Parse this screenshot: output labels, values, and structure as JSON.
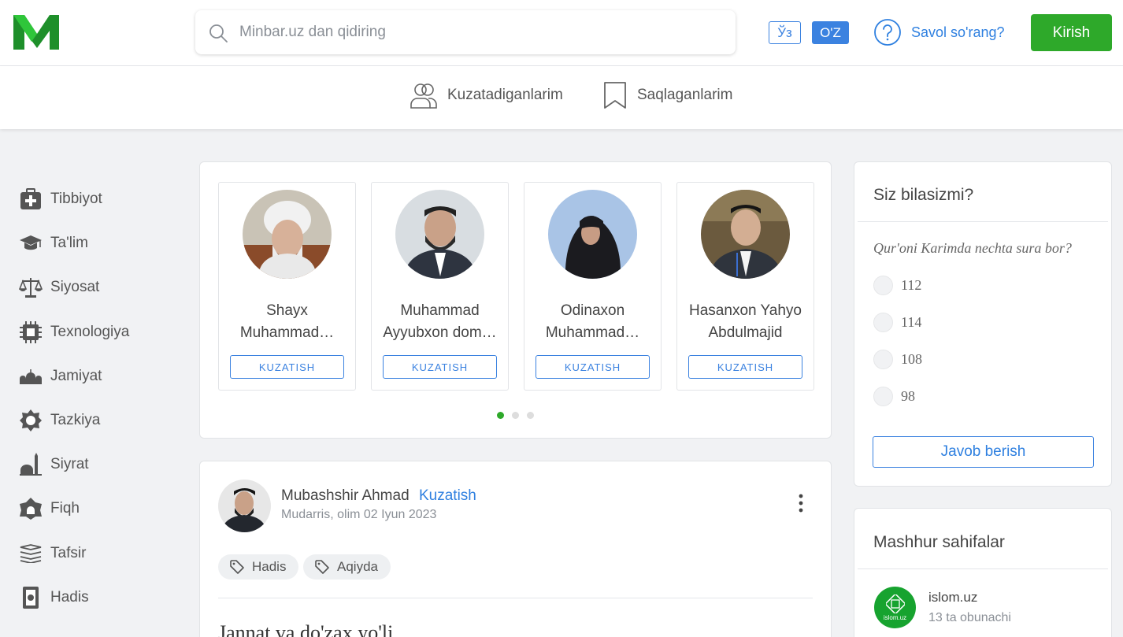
{
  "header": {
    "logo": "M",
    "search": {
      "placeholder": "Minbar.uz dan qidiring"
    },
    "lang_cyrillic": "Ўз",
    "lang_latin": "O'Z",
    "ask_label": "Savol so'rang?",
    "login_label": "Kirish"
  },
  "subnav": {
    "following": "Kuzatadiganlarim",
    "saved": "Saqlaganlarim"
  },
  "sidebar": {
    "items": [
      {
        "label": "Tibbiyot",
        "icon": "medical-kit-icon"
      },
      {
        "label": "Ta'lim",
        "icon": "graduation-cap-icon"
      },
      {
        "label": "Siyosat",
        "icon": "scales-icon"
      },
      {
        "label": "Texnologiya",
        "icon": "chip-icon"
      },
      {
        "label": "Jamiyat",
        "icon": "mosques-icon"
      },
      {
        "label": "Tazkiya",
        "icon": "star-badge-icon"
      },
      {
        "label": "Siyrat",
        "icon": "minaret-icon"
      },
      {
        "label": "Fiqh",
        "icon": "mosque-badge-icon"
      },
      {
        "label": "Tafsir",
        "icon": "books-icon"
      },
      {
        "label": "Hadis",
        "icon": "book-icon"
      }
    ]
  },
  "authors": {
    "follow_label": "KUZATISH",
    "items": [
      {
        "name_line1": "Shayx",
        "name_line2": "Muhammad…"
      },
      {
        "name_line1": "Muhammad",
        "name_line2": "Ayyubxon dom…"
      },
      {
        "name_line1": "Odinaxon",
        "name_line2": "Muhammad…"
      },
      {
        "name_line1": "Hasanxon Yahyo",
        "name_line2": "Abdulmajid"
      }
    ]
  },
  "post": {
    "author": "Mubashshir Ahmad",
    "follow_label": "Kuzatish",
    "meta": "Mudarris, olim 02 Iyun 2023",
    "tags": [
      "Hadis",
      "Aqiyda"
    ],
    "title": "Jannat va do'zax yo'li"
  },
  "quiz": {
    "title": "Siz bilasizmi?",
    "question": "Qur'oni Karimda nechta sura bor?",
    "options": [
      "112",
      "114",
      "108",
      "98"
    ],
    "submit_label": "Javob berish"
  },
  "popular": {
    "title": "Mashhur sahifalar",
    "items": [
      {
        "name": "islom.uz",
        "subscribers": "13 ta obunachi",
        "logo_text": "islom.uz"
      }
    ]
  },
  "colors": {
    "brand_green": "#2ea92a",
    "link_blue": "#2f80e0",
    "background": "#f1f2f4"
  }
}
